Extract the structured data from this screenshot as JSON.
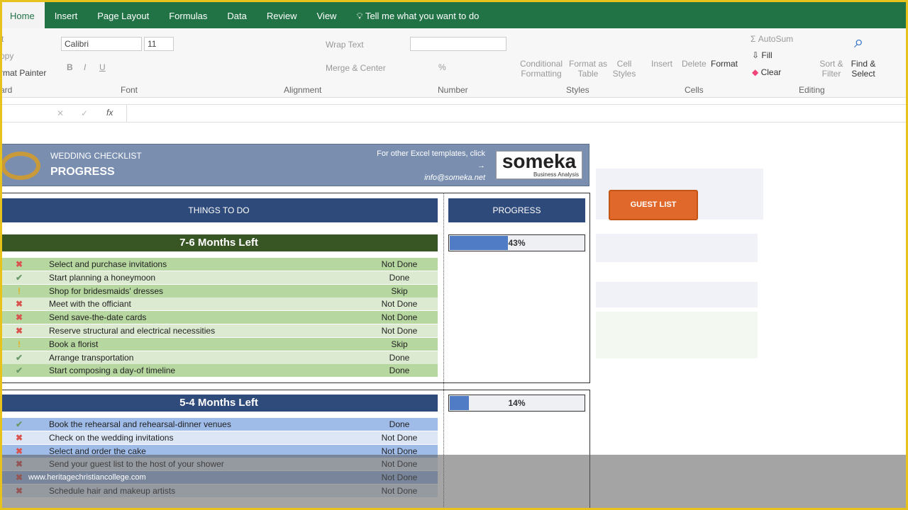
{
  "ribbon_tabs": [
    "Home",
    "Insert",
    "Page Layout",
    "Formulas",
    "Data",
    "Review",
    "View"
  ],
  "tell_me": "Tell me what you want to do",
  "clipboard": {
    "cut": "t",
    "copy": "opy",
    "format_painter": "rmat Painter",
    "group": "ard"
  },
  "font": {
    "name": "Calibri",
    "size": "11",
    "group": "Font"
  },
  "alignment": {
    "wrap": "Wrap Text",
    "merge": "Merge & Center",
    "group": "Alignment"
  },
  "number": {
    "group": "Number"
  },
  "styles": {
    "conditional": "Conditional Formatting",
    "format_table": "Format as Table",
    "cell_styles": "Cell Styles",
    "group": "Styles"
  },
  "cells": {
    "insert": "Insert",
    "delete": "Delete",
    "format": "Format",
    "group": "Cells"
  },
  "editing": {
    "autosum": "AutoSum",
    "fill": "Fill",
    "clear": "Clear",
    "sort": "Sort & Filter",
    "find": "Find & Select",
    "group": "Editing"
  },
  "formula_bar": {
    "fx": "fx",
    "value": ""
  },
  "banner": {
    "subtitle": "WEDDING CHECKLIST",
    "title": "PROGRESS",
    "link": "For other Excel templates, click",
    "arrow": "→",
    "email": "info@someka.net",
    "logo": "someka",
    "logo_sub": "Business Analysis"
  },
  "headers": {
    "things": "THINGS TO DO",
    "progress": "PROGRESS"
  },
  "guest_button": "GUEST LIST",
  "sections": [
    {
      "title": "7-6 Months Left",
      "progress_pct": 43,
      "progress_label": "43%",
      "color": "#375623",
      "items": [
        {
          "icon": "x",
          "task": "Select and purchase invitations",
          "status": "Not Done"
        },
        {
          "icon": "check",
          "task": "Start planning a honeymoon",
          "status": "Done"
        },
        {
          "icon": "skip",
          "task": "Shop for bridesmaids' dresses",
          "status": "Skip"
        },
        {
          "icon": "x",
          "task": "Meet with the officiant",
          "status": "Not Done"
        },
        {
          "icon": "x",
          "task": "Send save-the-date cards",
          "status": "Not Done"
        },
        {
          "icon": "x",
          "task": "Reserve structural and electrical necessities",
          "status": "Not Done"
        },
        {
          "icon": "skip",
          "task": "Book a florist",
          "status": "Skip"
        },
        {
          "icon": "check",
          "task": "Arrange transportation",
          "status": "Done"
        },
        {
          "icon": "check",
          "task": "Start composing a day-of timeline",
          "status": "Done"
        }
      ]
    },
    {
      "title": "5-4 Months Left",
      "progress_pct": 14,
      "progress_label": "14%",
      "color": "#2f4b7c",
      "items": [
        {
          "icon": "check",
          "task": "Book the rehearsal and rehearsal-dinner venues",
          "status": "Done"
        },
        {
          "icon": "x",
          "task": "Check on the wedding invitations",
          "status": "Not Done"
        },
        {
          "icon": "x",
          "task": "Select and order the cake",
          "status": "Not Done"
        },
        {
          "icon": "x",
          "task": "Send your guest list to the host of your shower",
          "status": "Not Done"
        },
        {
          "icon": "x",
          "task": "",
          "status": "Not Done"
        },
        {
          "icon": "x",
          "task": "Schedule hair and makeup artists",
          "status": "Not Done"
        }
      ]
    }
  ],
  "watermark": "www.heritagechristiancollege.com"
}
